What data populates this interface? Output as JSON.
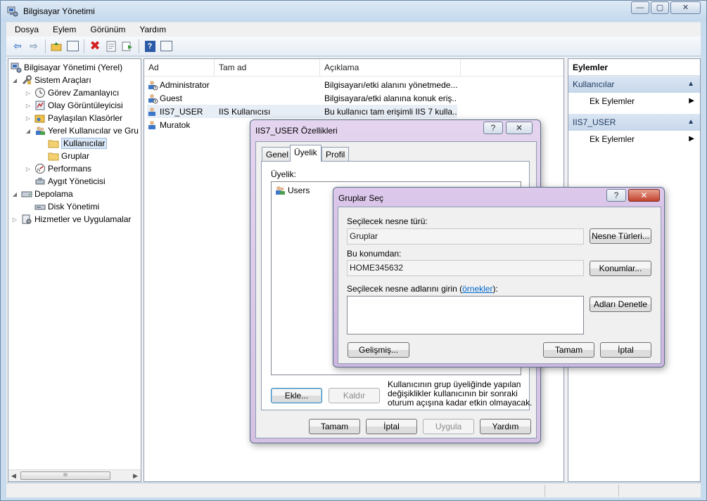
{
  "window": {
    "title": "Bilgisayar Yönetimi",
    "min": "—",
    "max": "▢",
    "close": "✕"
  },
  "menu": [
    "Dosya",
    "Eylem",
    "Görünüm",
    "Yardım"
  ],
  "tree": {
    "root": "Bilgisayar Yönetimi (Yerel)",
    "items": [
      "Sistem Araçları",
      "Görev Zamanlayıcı",
      "Olay Görüntüleyicisi",
      "Paylaşılan Klasörler",
      "Yerel Kullanıcılar ve Gru",
      "Kullanıcılar",
      "Gruplar",
      "Performans",
      "Aygıt Yöneticisi",
      "Depolama",
      "Disk Yönetimi",
      "Hizmetler ve Uygulamalar"
    ],
    "scroll_thumb": "III"
  },
  "list": {
    "columns": [
      "Ad",
      "Tam ad",
      "Açıklama"
    ],
    "rows": [
      {
        "name": "Administrator",
        "fullname": "",
        "desc": "Bilgisayarı/etki alanını yönetmede..."
      },
      {
        "name": "Guest",
        "fullname": "",
        "desc": "Bilgisayara/etki alanına konuk eriş..."
      },
      {
        "name": "IIS7_USER",
        "fullname": "IIS Kullanıcısı",
        "desc": "Bu kullanıcı tam erişimli IIS 7 kulla..."
      },
      {
        "name": "Muratok",
        "fullname": "",
        "desc": ""
      }
    ]
  },
  "actions": {
    "title": "Eylemler",
    "section1": "Kullanıcılar",
    "section1_item": "Ek Eylemler",
    "section2": "IIS7_USER",
    "section2_item": "Ek Eylemler"
  },
  "props_dialog": {
    "title": "IIS7_USER Özellikleri",
    "help": "?",
    "close": "✕",
    "tabs": [
      "Genel",
      "Üyelik",
      "Profil"
    ],
    "membership_label": "Üyelik:",
    "member": "Users",
    "add": "Ekle...",
    "remove": "Kaldır",
    "note": [
      "Kullanıcının grup üyeliğinde yapılan",
      "değişiklikler kullanıcının bir sonraki",
      "oturum açışına kadar etkin olmayacak."
    ],
    "ok": "Tamam",
    "cancel": "İptal",
    "apply": "Uygula",
    "help_button": "Yardım"
  },
  "groups_dialog": {
    "title": "Gruplar Seç",
    "help": "?",
    "close": "✕",
    "object_type_label": "Seçilecek nesne türü:",
    "object_type_value": "Gruplar",
    "object_types_button": "Nesne Türleri...",
    "location_label": "Bu konumdan:",
    "location_value": "HOME345632",
    "locations_button": "Konumlar...",
    "names_label_prefix": "Seçilecek nesne adlarını girin (",
    "names_label_link": "örnekler",
    "names_label_suffix": "):",
    "check_names": "Adları Denetle",
    "advanced": "Gelişmiş...",
    "ok": "Tamam",
    "cancel": "İptal"
  }
}
